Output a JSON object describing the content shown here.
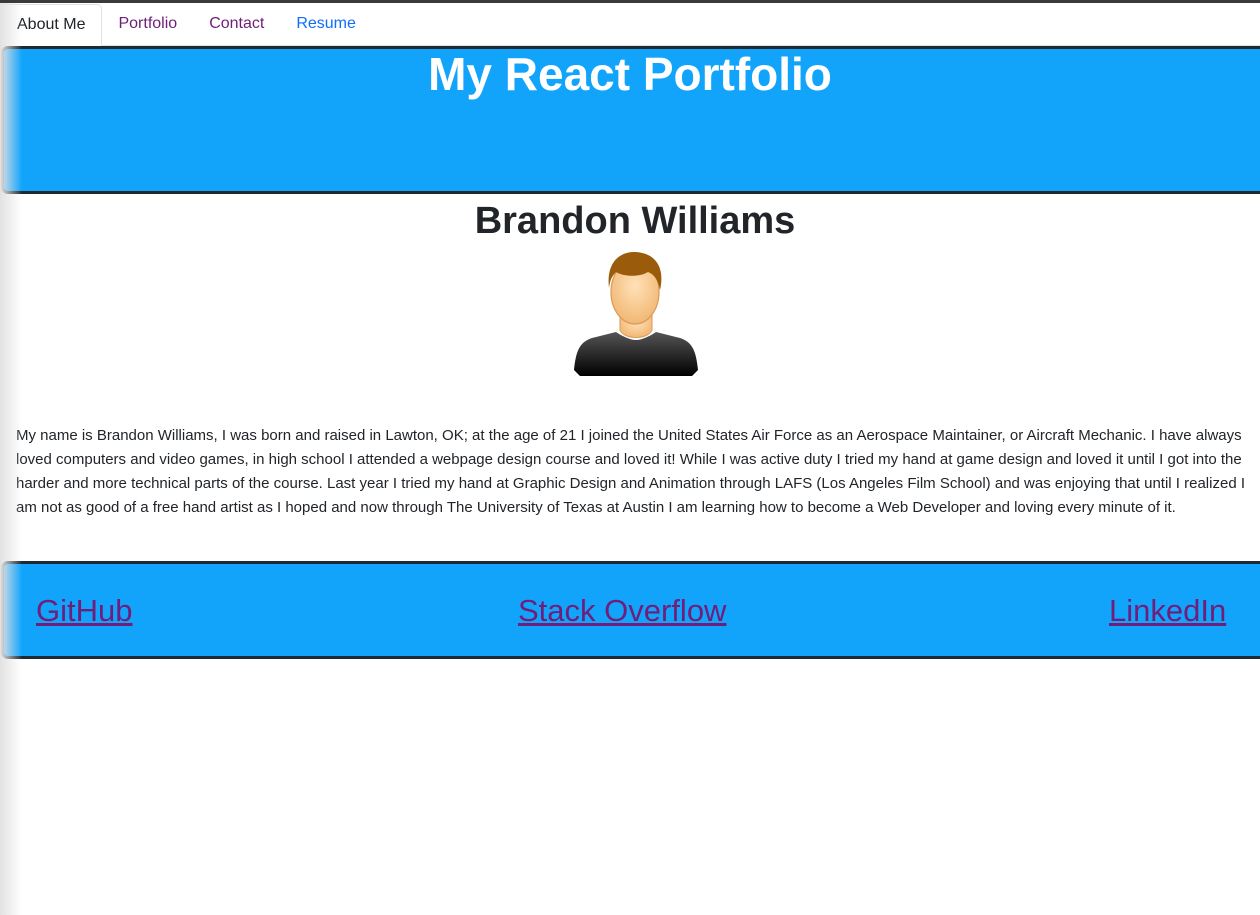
{
  "nav": {
    "tabs": [
      {
        "label": "About Me",
        "state": "active"
      },
      {
        "label": "Portfolio",
        "state": "visited"
      },
      {
        "label": "Contact",
        "state": "visited"
      },
      {
        "label": "Resume",
        "state": "link"
      }
    ]
  },
  "header": {
    "title": "My React Portfolio"
  },
  "profile": {
    "name": "Brandon Williams",
    "avatar_icon": "person-avatar-icon",
    "bio": "My name is Brandon Williams, I was born and raised in Lawton, OK; at the age of 21 I joined the United States Air Force as an Aerospace Maintainer, or Aircraft Mechanic. I have always loved computers and video games, in high school I attended a webpage design course and loved it! While I was active duty I tried my hand at game design and loved it until I got into the harder and more technical parts of the course. Last year I tried my hand at Graphic Design and Animation through LAFS (Los Angeles Film School) and was enjoying that until I realized I am not as good of a free hand artist as I hoped and now through The University of Texas at Austin I am learning how to become a Web Developer and loving every minute of it."
  },
  "footer": {
    "links": [
      {
        "label": "GitHub"
      },
      {
        "label": "Stack Overflow"
      },
      {
        "label": "LinkedIn"
      }
    ]
  },
  "colors": {
    "banner": "#12a4fb",
    "border": "#1e2a33",
    "visited_link": "#6f1e7a",
    "link": "#0d6efd",
    "text": "#212529"
  }
}
